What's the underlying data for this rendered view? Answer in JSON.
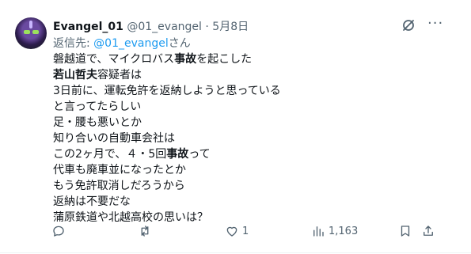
{
  "tweet": {
    "display_name": "Evangel_01",
    "handle": "@01_evangel",
    "separator": "·",
    "date": "5月8日",
    "reply_prefix": "返信先: ",
    "reply_handle": "@01_evangel",
    "reply_suffix": "さん",
    "lines": [
      [
        {
          "t": "磐越道で、マイクロバス"
        },
        {
          "t": "事故",
          "b": true
        },
        {
          "t": "を起こした"
        }
      ],
      [
        {
          "t": "若山哲夫",
          "b": true
        },
        {
          "t": "容疑者は"
        }
      ],
      [
        {
          "t": "3日前に、運転免許を返納しようと思っている"
        }
      ],
      [
        {
          "t": "と言ってたらしい"
        }
      ],
      [
        {
          "t": "足・腰も悪いとか"
        }
      ],
      [
        {
          "t": "知り合いの自動車会社は"
        }
      ],
      [
        {
          "t": "この2ヶ月で、４・5回"
        },
        {
          "t": "事故",
          "b": true
        },
        {
          "t": "って"
        }
      ],
      [
        {
          "t": "代車も廃車並になったとか"
        }
      ],
      [
        {
          "t": "もう免許取消しだろうから"
        }
      ],
      [
        {
          "t": "返納は不要だな"
        }
      ],
      [
        {
          "t": "蒲原鉄道や北越高校の思いは？"
        }
      ]
    ]
  },
  "actions": {
    "reply_count": "",
    "retweet_count": "",
    "like_count": "1",
    "views_count": "1,163"
  },
  "colors": {
    "secondary_text": "#536471",
    "link": "#1d9bf0",
    "primary_text": "#0f1419"
  }
}
